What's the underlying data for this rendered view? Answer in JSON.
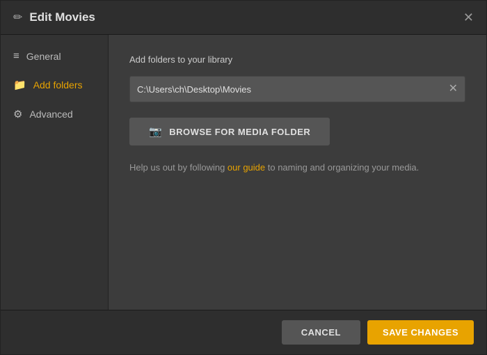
{
  "dialog": {
    "title": "Edit Movies",
    "close_label": "✕"
  },
  "sidebar": {
    "items": [
      {
        "id": "general",
        "label": "General",
        "icon": "≡",
        "active": false
      },
      {
        "id": "add-folders",
        "label": "Add folders",
        "icon": "folder",
        "active": true
      },
      {
        "id": "advanced",
        "label": "Advanced",
        "icon": "gear",
        "active": false
      }
    ]
  },
  "main": {
    "section_label": "Add folders to your library",
    "folder_path": "C:\\Users\\ch\\Desktop\\Movies",
    "browse_button_label": "BROWSE FOR MEDIA FOLDER",
    "help_text_before": "Help us out by following ",
    "guide_link_label": "our guide",
    "help_text_after": " to naming and organizing your media."
  },
  "footer": {
    "cancel_label": "CANCEL",
    "save_label": "SAVE CHANGES"
  }
}
